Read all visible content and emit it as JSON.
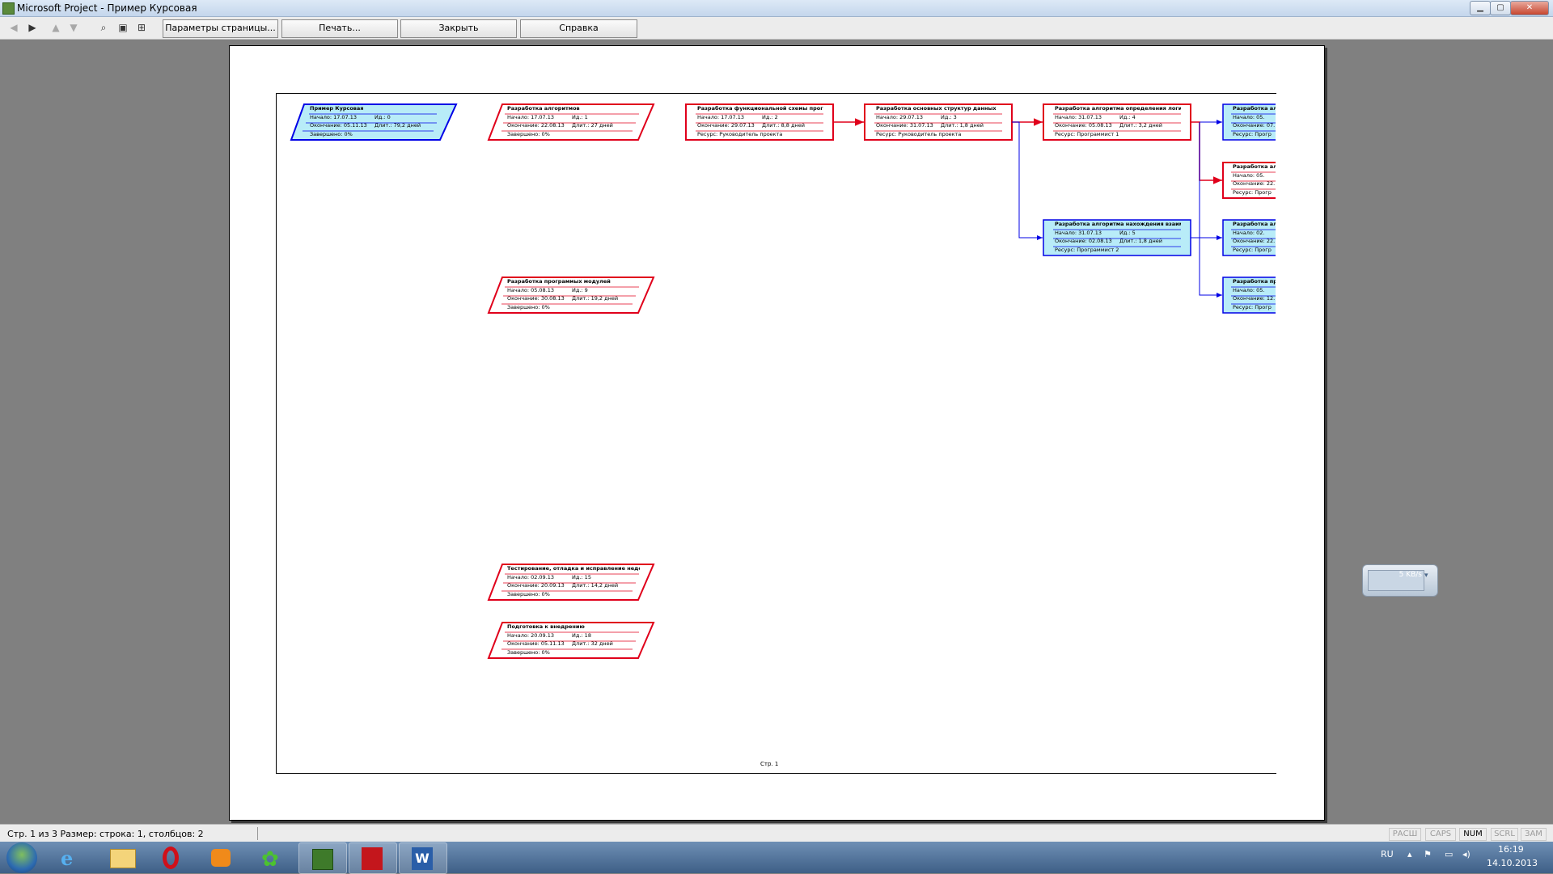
{
  "window": {
    "title": "Microsoft Project - Пример Курсовая",
    "min": "▁",
    "max": "▢",
    "close": "✕"
  },
  "toolbar": {
    "icons": [
      "prev-page-icon",
      "next-page-icon",
      "page-up-icon",
      "page-down-icon",
      "zoom-icon",
      "one-page-icon",
      "multi-page-icon"
    ],
    "page_setup": "Параметры страницы...",
    "print": "Печать...",
    "close": "Закрыть",
    "help": "Справка"
  },
  "page": {
    "number_label": "Стр. 1"
  },
  "nodes": [
    {
      "id": "n0",
      "title": "Пример Курсовая",
      "start": "Начало:    17.07.13",
      "id_label": "Ид.:    0",
      "finish": "Окончание: 05.11.13",
      "dur": "Длит.: 79,2 дней",
      "extra": "Завершено: 0%",
      "shape": "summary"
    },
    {
      "id": "n1",
      "title": "Разработка алгоритмов",
      "start": "Начало:    17.07.13",
      "id_label": "Ид.:    1",
      "finish": "Окончание: 22.08.13",
      "dur": "Длит.: 27 дней",
      "extra": "Завершено: 0%",
      "shape": "para"
    },
    {
      "id": "n2",
      "title": "Разработка функциональной схемы програ",
      "start": "Начало:    17.07.13",
      "id_label": "Ид.:    2",
      "finish": "Окончание: 29.07.13",
      "dur": "Длит.: 8,8 дней",
      "extra": "Ресурс:    Руководитель проекта",
      "shape": "rect"
    },
    {
      "id": "n3",
      "title": "Разработка основных структур данных",
      "start": "Начало:    29.07.13",
      "id_label": "Ид.:    3",
      "finish": "Окончание: 31.07.13",
      "dur": "Длит.: 1,8 дней",
      "extra": "Ресурс:    Руководитель проекта",
      "shape": "rect"
    },
    {
      "id": "n4",
      "title": "Разработка алгоритма определения логичес",
      "start": "Начало:    31.07.13",
      "id_label": "Ид.:    4",
      "finish": "Окончание: 05.08.13",
      "dur": "Длит.: 3,2 дней",
      "extra": "Ресурс:    Программист 1",
      "shape": "rect"
    },
    {
      "id": "n5",
      "title": "Разработка алгоритма нахождения взаимно",
      "start": "Начало:    31.07.13",
      "id_label": "Ид.:    5",
      "finish": "Окончание: 02.08.13",
      "dur": "Длит.: 1,8 дней",
      "extra": "Ресурс:    Программист 2",
      "shape": "rect-blue"
    },
    {
      "id": "n9",
      "title": "Разработка программых модулей",
      "start": "Начало:    05.08.13",
      "id_label": "Ид.:    9",
      "finish": "Окончание: 30.08.13",
      "dur": "Длит.: 19,2 дней",
      "extra": "Завершено: 0%",
      "shape": "para"
    },
    {
      "id": "n15",
      "title": "Тестирование, отладка и исправление недочет",
      "start": "Начало:    02.09.13",
      "id_label": "Ид.:    15",
      "finish": "Окончание: 20.09.13",
      "dur": "Длит.: 14,2 дней",
      "extra": "Завершено: 0%",
      "shape": "para"
    },
    {
      "id": "n18",
      "title": "Подготовка к внедрению",
      "start": "Начало:    20.09.13",
      "id_label": "Ид.:    18",
      "finish": "Окончание: 05.11.13",
      "dur": "Длит.: 32 дней",
      "extra": "Завершено: 0%",
      "shape": "para"
    },
    {
      "id": "c1",
      "title": "Разработка алг",
      "start": "Начало:     05.",
      "id_label": "",
      "finish": "Окончание: 07.",
      "dur": "",
      "extra": "Ресурс:    Прогр",
      "shape": "clip-blue"
    },
    {
      "id": "c2",
      "title": "Разработка алг",
      "start": "Начало:     05.",
      "id_label": "",
      "finish": "Окончание: 22.",
      "dur": "",
      "extra": "Ресурс:    Прогр",
      "shape": "clip-red"
    },
    {
      "id": "c3",
      "title": "Разработка алг",
      "start": "Начало:     02.",
      "id_label": "",
      "finish": "Окончание: 22.",
      "dur": "",
      "extra": "Ресурс:    Прогр",
      "shape": "clip-blue"
    },
    {
      "id": "c4",
      "title": "Разработка прог",
      "start": "Начало:     05.",
      "id_label": "",
      "finish": "Окончание: 12.",
      "dur": "",
      "extra": "Ресурс:    Прогр",
      "shape": "clip-blue"
    }
  ],
  "widget": {
    "speed": "5 KB/s"
  },
  "status": {
    "left": "Стр. 1 из 3  Размер: строка: 1, столбцов: 2",
    "indicators": [
      {
        "label": "РАСШ",
        "on": false
      },
      {
        "label": "CAPS",
        "on": false
      },
      {
        "label": "NUM",
        "on": true
      },
      {
        "label": "SCRL",
        "on": false
      },
      {
        "label": "ЗАМ",
        "on": false
      }
    ]
  },
  "taskbar": {
    "items": [
      "start-orb",
      "ie-icon",
      "explorer-icon",
      "opera-icon",
      "media-player-icon",
      "icq-icon",
      "project-icon",
      "acrobat-icon",
      "word-icon"
    ],
    "lang": "RU",
    "time": "16:19",
    "date": "14.10.2013"
  },
  "colors": {
    "red": "#e0001b",
    "blue": "#0000e6",
    "fill_blue": "#b8ecf8"
  }
}
